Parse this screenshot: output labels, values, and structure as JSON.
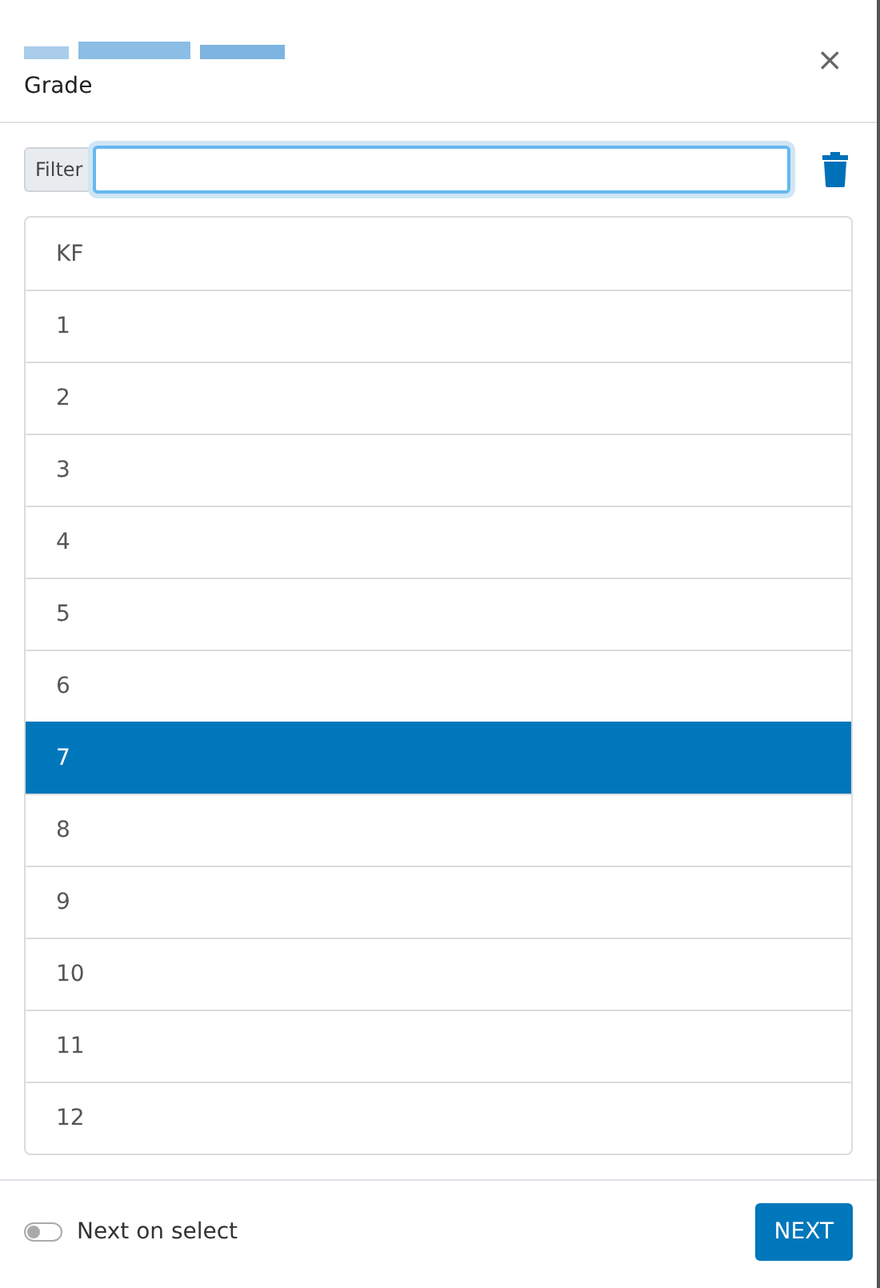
{
  "dialog": {
    "subtitle": "Grade",
    "close": "×"
  },
  "filter": {
    "label": "Filter"
  },
  "items": [
    {
      "label": "KF",
      "selected": false
    },
    {
      "label": "1",
      "selected": false
    },
    {
      "label": "2",
      "selected": false
    },
    {
      "label": "3",
      "selected": false
    },
    {
      "label": "4",
      "selected": false
    },
    {
      "label": "5",
      "selected": false
    },
    {
      "label": "6",
      "selected": false
    },
    {
      "label": "7",
      "selected": true
    },
    {
      "label": "8",
      "selected": false
    },
    {
      "label": "9",
      "selected": false
    },
    {
      "label": "10",
      "selected": false
    },
    {
      "label": "11",
      "selected": false
    },
    {
      "label": "12",
      "selected": false
    }
  ],
  "footer": {
    "toggle": {
      "label": "Next on select",
      "on": false
    },
    "button": "NEXT"
  }
}
